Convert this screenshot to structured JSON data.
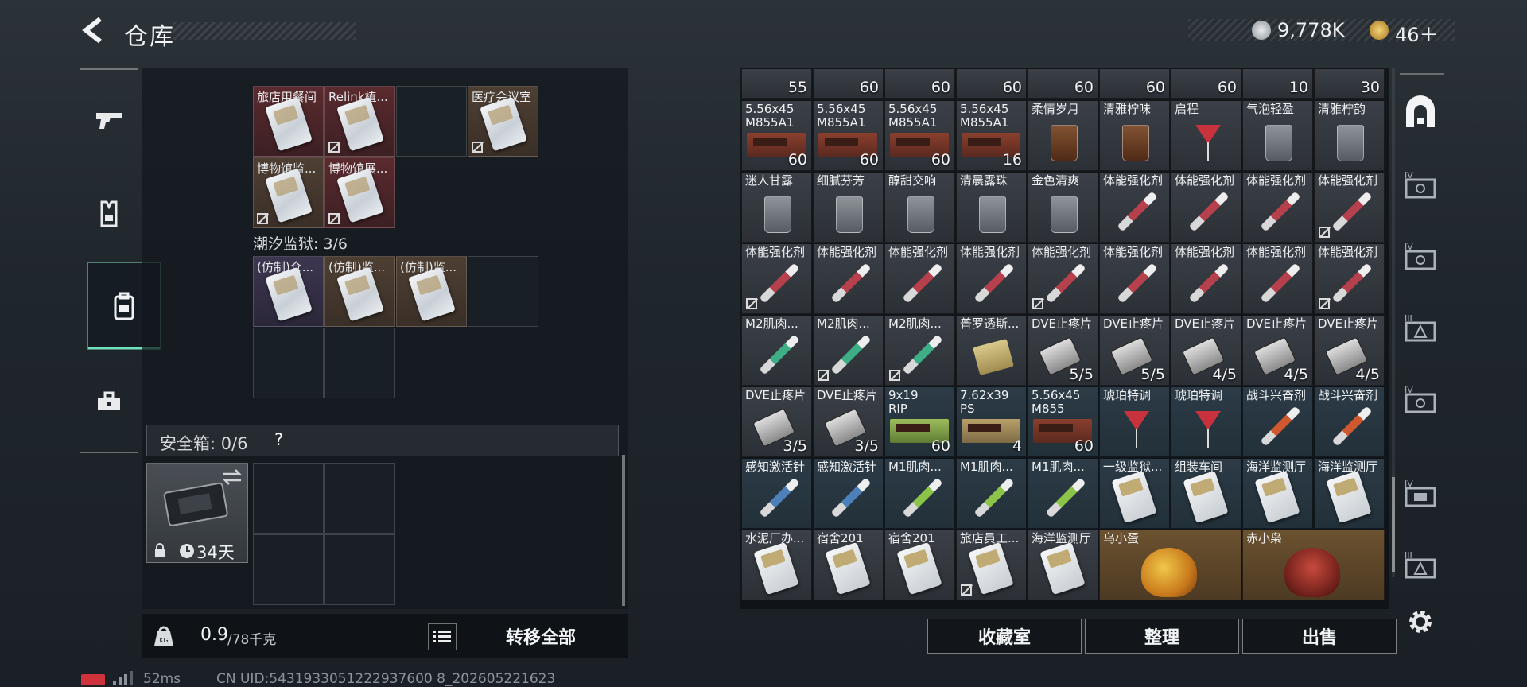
{
  "header": {
    "title": "仓库"
  },
  "currency": [
    {
      "icon": "silver-coin-icon",
      "value": "9,778K"
    },
    {
      "icon": "gold-coin-icon",
      "value": "46＋"
    }
  ],
  "left_nav": [
    {
      "name": "weapons",
      "icon": "gun-icon"
    },
    {
      "name": "gear",
      "icon": "vest-icon"
    },
    {
      "name": "backpack",
      "icon": "backpack-icon"
    },
    {
      "name": "toolbox",
      "icon": "toolbox-icon"
    }
  ],
  "storage": {
    "section1_cells": [
      {
        "label": "旅店用餐间",
        "color": "red",
        "locked": false
      },
      {
        "label": "Relink植...",
        "color": "red",
        "locked": true
      },
      {
        "label": "",
        "color": "empty",
        "locked": false
      },
      {
        "label": "医疗会议室",
        "color": "brown",
        "locked": true
      },
      {
        "label": "博物馆监...",
        "color": "brown",
        "locked": true
      },
      {
        "label": "博物馆展...",
        "color": "red",
        "locked": true
      }
    ],
    "section2_title": "潮汐监狱: 3/6",
    "section2_cells": [
      {
        "label": "(仿制)仓...",
        "color": "purple"
      },
      {
        "label": "(仿制)监...",
        "color": "brown"
      },
      {
        "label": "(仿制)监...",
        "color": "brown"
      }
    ],
    "safe_box_label": "安全箱: 0/6",
    "safe_box_help": "?",
    "safe_box_days": "34天",
    "weight": "0.9",
    "weight_unit": "/78千克",
    "transfer_all": "转移全部"
  },
  "grid": {
    "top_counts": [
      "55",
      "60",
      "60",
      "60",
      "60",
      "60",
      "60",
      "10",
      "30"
    ],
    "rows": [
      [
        {
          "label": "5.56x45\nM855A1",
          "count": "60",
          "kind": "ammo",
          "bg": "gray"
        },
        {
          "label": "5.56x45\nM855A1",
          "count": "60",
          "kind": "ammo",
          "bg": "gray"
        },
        {
          "label": "5.56x45\nM855A1",
          "count": "60",
          "kind": "ammo",
          "bg": "gray"
        },
        {
          "label": "5.56x45\nM855A1",
          "count": "16",
          "kind": "ammo",
          "bg": "gray"
        },
        {
          "label": "柔情岁月",
          "count": "",
          "kind": "glass-amber",
          "bg": "gray"
        },
        {
          "label": "清雅柠味",
          "count": "",
          "kind": "glass-amber",
          "bg": "gray"
        },
        {
          "label": "启程",
          "count": "",
          "kind": "cocktail",
          "bg": "gray"
        },
        {
          "label": "气泡轻盈",
          "count": "",
          "kind": "glass",
          "bg": "gray"
        },
        {
          "label": "清雅柠韵",
          "count": "",
          "kind": "glass",
          "bg": "gray"
        }
      ],
      [
        {
          "label": "迷人甘露",
          "count": "",
          "kind": "glass",
          "bg": "gray"
        },
        {
          "label": "细腻芬芳",
          "count": "",
          "kind": "glass",
          "bg": "gray"
        },
        {
          "label": "醇甜交响",
          "count": "",
          "kind": "glass",
          "bg": "gray"
        },
        {
          "label": "清晨露珠",
          "count": "",
          "kind": "glass",
          "bg": "gray"
        },
        {
          "label": "金色清爽",
          "count": "",
          "kind": "glass",
          "bg": "gray"
        },
        {
          "label": "体能强化剂",
          "count": "",
          "kind": "syringe",
          "bg": "gray"
        },
        {
          "label": "体能强化剂",
          "count": "",
          "kind": "syringe",
          "bg": "gray"
        },
        {
          "label": "体能强化剂",
          "count": "",
          "kind": "syringe",
          "bg": "gray"
        },
        {
          "label": "体能强化剂",
          "count": "",
          "kind": "syringe",
          "bg": "gray",
          "locked": true
        }
      ],
      [
        {
          "label": "体能强化剂",
          "count": "",
          "kind": "syringe",
          "bg": "gray",
          "locked": true
        },
        {
          "label": "体能强化剂",
          "count": "",
          "kind": "syringe",
          "bg": "gray"
        },
        {
          "label": "体能强化剂",
          "count": "",
          "kind": "syringe",
          "bg": "gray"
        },
        {
          "label": "体能强化剂",
          "count": "",
          "kind": "syringe",
          "bg": "gray"
        },
        {
          "label": "体能强化剂",
          "count": "",
          "kind": "syringe",
          "bg": "gray",
          "locked": true
        },
        {
          "label": "体能强化剂",
          "count": "",
          "kind": "syringe",
          "bg": "gray"
        },
        {
          "label": "体能强化剂",
          "count": "",
          "kind": "syringe",
          "bg": "gray"
        },
        {
          "label": "体能强化剂",
          "count": "",
          "kind": "syringe",
          "bg": "gray"
        },
        {
          "label": "体能强化剂",
          "count": "",
          "kind": "syringe",
          "bg": "gray",
          "locked": true
        }
      ],
      [
        {
          "label": "M2肌肉...",
          "count": "",
          "kind": "syringe-green",
          "bg": "gray"
        },
        {
          "label": "M2肌肉...",
          "count": "",
          "kind": "syringe-green",
          "bg": "gray",
          "locked": true
        },
        {
          "label": "M2肌肉...",
          "count": "",
          "kind": "syringe-green",
          "bg": "gray",
          "locked": true
        },
        {
          "label": "普罗透斯...",
          "count": "",
          "kind": "pack",
          "bg": "gray"
        },
        {
          "label": "DVE止疼片",
          "count": "5/5",
          "kind": "pill",
          "bg": "gray"
        },
        {
          "label": "DVE止疼片",
          "count": "5/5",
          "kind": "pill",
          "bg": "gray"
        },
        {
          "label": "DVE止疼片",
          "count": "4/5",
          "kind": "pill",
          "bg": "gray"
        },
        {
          "label": "DVE止疼片",
          "count": "4/5",
          "kind": "pill",
          "bg": "gray"
        },
        {
          "label": "DVE止疼片",
          "count": "4/5",
          "kind": "pill",
          "bg": "gray"
        }
      ],
      [
        {
          "label": "DVE止疼片",
          "count": "3/5",
          "kind": "pill",
          "bg": "gray"
        },
        {
          "label": "DVE止疼片",
          "count": "3/5",
          "kind": "pill",
          "bg": "gray"
        },
        {
          "label": "9x19\nRIP",
          "count": "60",
          "kind": "ammo-green",
          "bg": "teal"
        },
        {
          "label": "7.62x39\nPS",
          "count": "4",
          "kind": "ammo-tan",
          "bg": "teal"
        },
        {
          "label": "5.56x45\nM855",
          "count": "60",
          "kind": "ammo",
          "bg": "teal"
        },
        {
          "label": "琥珀特调",
          "count": "",
          "kind": "cocktail",
          "bg": "teal"
        },
        {
          "label": "琥珀特调",
          "count": "",
          "kind": "cocktail",
          "bg": "teal"
        },
        {
          "label": "战斗兴奋剂",
          "count": "",
          "kind": "syringe-orange",
          "bg": "teal"
        },
        {
          "label": "战斗兴奋剂",
          "count": "",
          "kind": "syringe-orange",
          "bg": "teal"
        }
      ],
      [
        {
          "label": "感知激活针",
          "count": "",
          "kind": "syringe-blue",
          "bg": "teal"
        },
        {
          "label": "感知激活针",
          "count": "",
          "kind": "syringe-blue",
          "bg": "teal"
        },
        {
          "label": "M1肌肉...",
          "count": "",
          "kind": "syringe-lime",
          "bg": "teal"
        },
        {
          "label": "M1肌肉...",
          "count": "",
          "kind": "syringe-lime",
          "bg": "teal"
        },
        {
          "label": "M1肌肉...",
          "count": "",
          "kind": "syringe-lime",
          "bg": "teal"
        },
        {
          "label": "一级监狱...",
          "count": "",
          "kind": "card",
          "bg": "teal"
        },
        {
          "label": "组装车间",
          "count": "",
          "kind": "card",
          "bg": "teal"
        },
        {
          "label": "海洋监测厅",
          "count": "",
          "kind": "card",
          "bg": "teal"
        },
        {
          "label": "海洋监测厅",
          "count": "",
          "kind": "card",
          "bg": "teal"
        }
      ],
      [
        {
          "label": "水泥厂办...",
          "count": "",
          "kind": "card",
          "bg": "gray"
        },
        {
          "label": "宿舍201",
          "count": "",
          "kind": "card",
          "bg": "gray"
        },
        {
          "label": "宿舍201",
          "count": "",
          "kind": "card",
          "bg": "gray"
        },
        {
          "label": "旅店員工...",
          "count": "",
          "kind": "card",
          "bg": "gray",
          "locked": true
        },
        {
          "label": "海洋监测厅",
          "count": "",
          "kind": "card",
          "bg": "gray"
        }
      ]
    ],
    "wide_items": [
      {
        "label": "乌小蛋",
        "icon": "egg-figure-icon"
      },
      {
        "label": "赤小枭",
        "icon": "owl-figure-icon"
      }
    ]
  },
  "bottom_buttons": {
    "collection": "收藏室",
    "sort": "整理",
    "sell": "出售"
  },
  "footer": {
    "ping": "52ms",
    "uid": "CN UID:5431933051222937600 8_202605221623"
  }
}
